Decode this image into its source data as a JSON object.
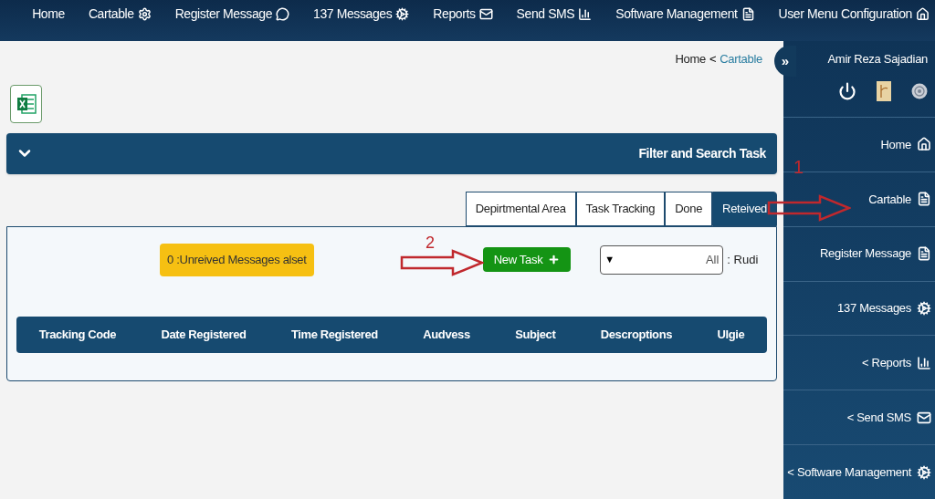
{
  "top_nav": [
    {
      "label": "Home"
    },
    {
      "label": "Cartable"
    },
    {
      "label": "Register Message"
    },
    {
      "label": "137 Messages"
    },
    {
      "label": "Reports"
    },
    {
      "label": "Send SMS"
    },
    {
      "label": "Software Management"
    },
    {
      "label": "User Menu Configuration"
    }
  ],
  "breadcrumb": {
    "items": [
      "Home",
      "Cartable"
    ],
    "separator": "<"
  },
  "filter_bar": {
    "title": "Filter and Search Task",
    "expanded": false
  },
  "tabs": [
    {
      "label": "Depirtmental Area",
      "selected": false
    },
    {
      "label": "Task Tracking",
      "selected": false
    },
    {
      "label": "Done",
      "selected": false
    },
    {
      "label": "Reteived",
      "selected": true
    }
  ],
  "unread_badge": "0 :Unreived Messages alset",
  "new_task_button": "New Task",
  "select": {
    "arrow": "▼",
    "value": "All",
    "label": ": Rudi"
  },
  "table": {
    "columns": [
      "Tracking Code",
      "Date Registered",
      "Time Registered",
      "Audvess",
      "Subject",
      "Descroptions",
      "Ulgie"
    ]
  },
  "sidebar": {
    "collapse": "»",
    "user": "Amir Reza Sajadian",
    "items": [
      {
        "label": "Home"
      },
      {
        "label": "Cartable"
      },
      {
        "label": "Register Message"
      },
      {
        "label": "137 Messages"
      },
      {
        "label": "< Reports"
      },
      {
        "label": "< Send SMS"
      },
      {
        "label": "< Software Management"
      }
    ]
  },
  "annotations": [
    {
      "number": "1"
    },
    {
      "number": "2"
    }
  ]
}
